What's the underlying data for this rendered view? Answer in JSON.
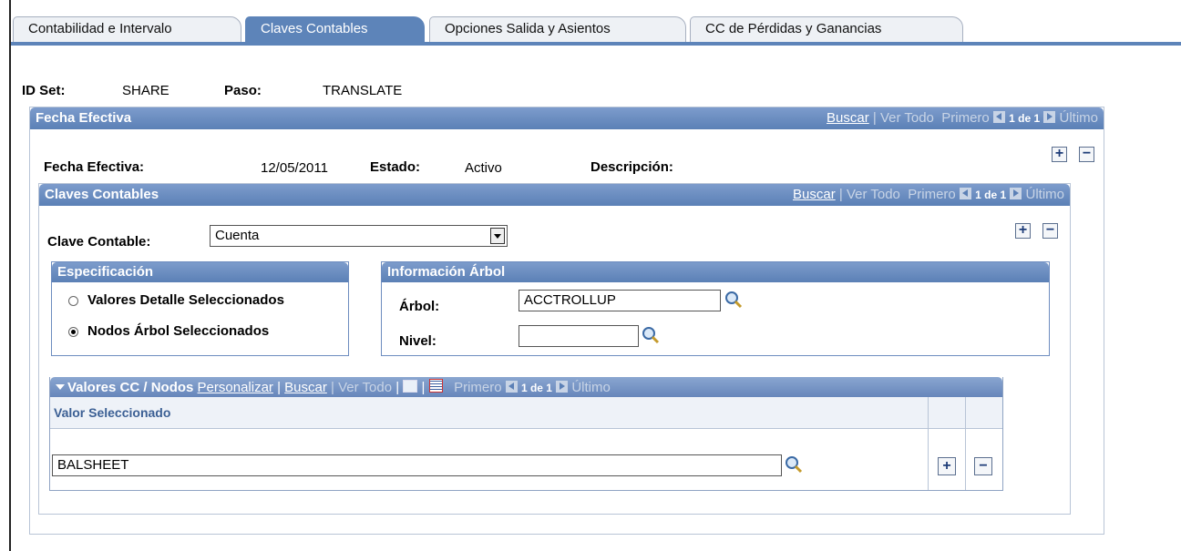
{
  "tabs": [
    {
      "label": "Contabilidad e Intervalo",
      "active": false
    },
    {
      "label": "Claves Contables",
      "active": true
    },
    {
      "label": "Opciones Salida y Asientos",
      "active": false
    },
    {
      "label": "CC de Pérdidas y Ganancias",
      "active": false
    }
  ],
  "header": {
    "setid_label": "ID Set:",
    "setid_value": "SHARE",
    "paso_label": "Paso:",
    "paso_value": "TRANSLATE"
  },
  "fecha_efectiva_box": {
    "title": "Fecha Efectiva",
    "nav": {
      "buscar": "Buscar",
      "ver_todo": "Ver Todo",
      "primero": "Primero",
      "count": "1 de 1",
      "ultimo": "Último"
    },
    "fecha_label": "Fecha Efectiva:",
    "fecha_value": "12/05/2011",
    "estado_label": "Estado:",
    "estado_value": "Activo",
    "descripcion_label": "Descripción:"
  },
  "claves_box": {
    "title": "Claves Contables",
    "nav": {
      "buscar": "Buscar",
      "ver_todo": "Ver Todo",
      "primero": "Primero",
      "count": "1 de 1",
      "ultimo": "Último"
    },
    "clave_label": "Clave Contable:",
    "clave_value": "Cuenta"
  },
  "especificacion": {
    "title": "Especificación",
    "options": [
      {
        "label": "Valores Detalle Seleccionados",
        "selected": false
      },
      {
        "label": "Nodos Árbol Seleccionados",
        "selected": true
      }
    ]
  },
  "arbol_info": {
    "title": "Información Árbol",
    "arbol_label": "Árbol:",
    "arbol_value": "ACCTROLLUP",
    "nivel_label": "Nivel:",
    "nivel_value": ""
  },
  "valores_grid": {
    "title": "Valores CC / Nodos",
    "personalizar": "Personalizar",
    "buscar": "Buscar",
    "ver_todo": "Ver Todo",
    "primero": "Primero",
    "count": "1 de 1",
    "ultimo": "Último",
    "column_header": "Valor Seleccionado",
    "rows": [
      {
        "value": "BALSHEET"
      }
    ]
  },
  "colors": {
    "accent": "#5d84b9",
    "header": "#6686bb"
  },
  "icons": [
    "lookup-icon",
    "add-row-icon",
    "delete-row-icon",
    "dropdown-arrow-icon",
    "collapse-icon",
    "zoom-icon",
    "download-icon"
  ]
}
